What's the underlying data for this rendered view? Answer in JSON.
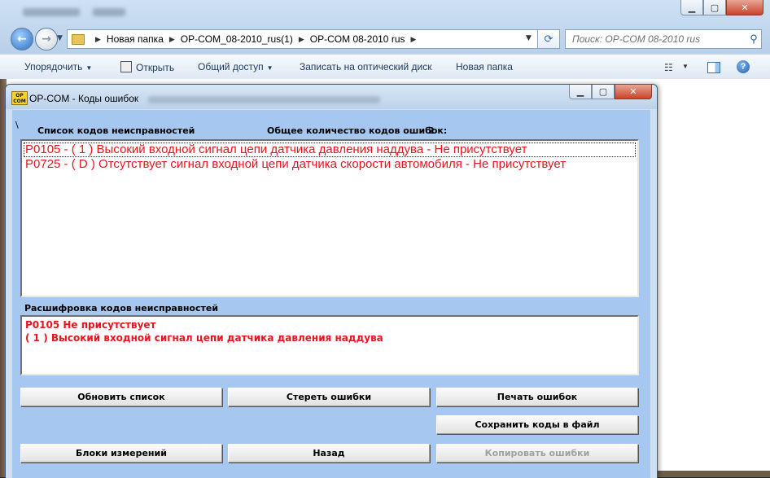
{
  "explorer": {
    "breadcrumbs": [
      "Новая папка",
      "OP-COM_08-2010_rus(1)",
      "OP-COM 08-2010 rus"
    ],
    "search_placeholder": "Поиск: OP-COM 08-2010 rus",
    "toolbar": {
      "organize": "Упорядочить",
      "open": "Открыть",
      "share": "Общий доступ",
      "burn": "Записать на оптический диск",
      "new_folder": "Новая папка"
    }
  },
  "opcom": {
    "title": "OP-COM - Коды ошибок",
    "path_marker": "\\",
    "list_label": "Список кодов неисправностей",
    "count_label": "Общее количество кодов ошибок:",
    "count_value": "2",
    "codes": [
      "P0105 - ( 1 )  Высокий входной сигнал цепи датчика давления наддува  - Не присутствует",
      "P0725 - ( D )  Отсутствует сигнал входной цепи датчика скорости автомобиля - Не присутствует"
    ],
    "decode_label": "Расшифровка кодов неисправностей",
    "decode_lines": [
      "P0105  Не присутствует",
      "( 1 )  Высокий входной сигнал цепи датчика давления наддува"
    ],
    "buttons": {
      "refresh": "Обновить список",
      "erase": "Стереть ошибки",
      "print": "Печать ошибок",
      "save": "Сохранить коды в файл",
      "blocks": "Блоки измерений",
      "back": "Назад",
      "copy": "Копировать ошибки"
    }
  }
}
